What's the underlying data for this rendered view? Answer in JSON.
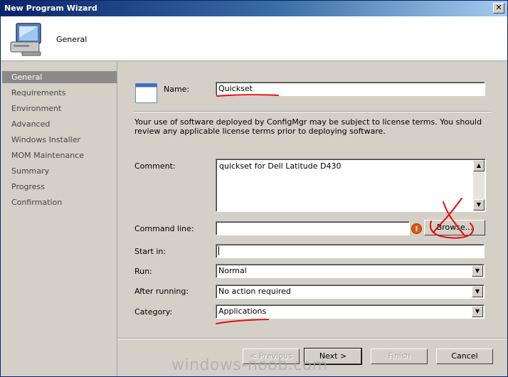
{
  "window": {
    "title": "New Program Wizard",
    "close_glyph": "✕"
  },
  "header": {
    "title": "General",
    "icon": "computer-monitor-icon"
  },
  "nav": {
    "items": [
      {
        "label": "General",
        "active": true
      },
      {
        "label": "Requirements",
        "active": false
      },
      {
        "label": "Environment",
        "active": false
      },
      {
        "label": "Advanced",
        "active": false
      },
      {
        "label": "Windows Installer",
        "active": false
      },
      {
        "label": "MOM Maintenance",
        "active": false
      },
      {
        "label": "Summary",
        "active": false
      },
      {
        "label": "Progress",
        "active": false
      },
      {
        "label": "Confirmation",
        "active": false
      }
    ]
  },
  "form": {
    "name_label": "Name:",
    "name_value": "Quickset",
    "license_text": "Your use of software deployed by ConfigMgr may be subject to license terms. You should review any applicable license terms prior to deploying software.",
    "comment_label": "Comment:",
    "comment_value": "quickset for Dell Latitude D430",
    "command_line_label": "Command line:",
    "command_line_value": "",
    "browse_label": "Browse...",
    "start_in_label": "Start in:",
    "start_in_value": "",
    "run_label": "Run:",
    "run_value": "Normal",
    "after_running_label": "After running:",
    "after_running_value": "No action required",
    "category_label": "Category:",
    "category_value": "Applications"
  },
  "buttons": {
    "previous": "< Previous",
    "next": "Next >",
    "finish": "Finish",
    "cancel": "Cancel"
  },
  "watermark": "windows-noob.com",
  "colors": {
    "annotation": "#e01010",
    "titlebar": "#0a246a",
    "warning": "#e05a10"
  }
}
